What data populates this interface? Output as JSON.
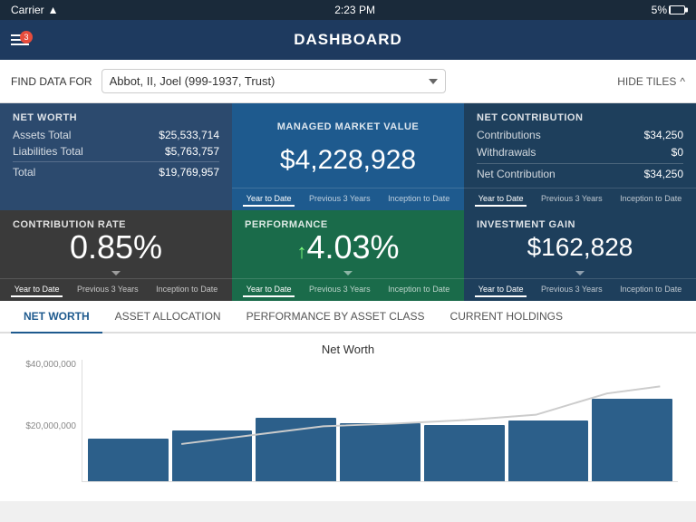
{
  "statusBar": {
    "carrier": "Carrier",
    "time": "2:23 PM",
    "battery": "5%"
  },
  "header": {
    "title": "DASHBOARD",
    "menuIcon": "☰",
    "notificationCount": "3"
  },
  "findData": {
    "label": "FIND DATA FOR",
    "selectedClient": "Abbot, II, Joel (999-1937, Trust)",
    "hideTilesLabel": "HIDE TILES"
  },
  "tiles": {
    "netWorth": {
      "title": "NET WORTH",
      "assetsLabel": "Assets Total",
      "assetsValue": "$25,533,714",
      "liabilitiesLabel": "Liabilities Total",
      "liabilitiesValue": "$5,763,757",
      "totalLabel": "Total",
      "totalValue": "$19,769,957"
    },
    "managedMarketValue": {
      "title": "MANAGED MARKET VALUE",
      "value": "$4,228,928",
      "dateTabs": [
        "Year to Date",
        "Previous 3 Years",
        "Inception to Date"
      ]
    },
    "netContribution": {
      "title": "NET CONTRIBUTION",
      "contributionsLabel": "Contributions",
      "contributionsValue": "$34,250",
      "withdrawalsLabel": "Withdrawals",
      "withdrawalsValue": "$0",
      "netContributionLabel": "Net Contribution",
      "netContributionValue": "$34,250",
      "dateTabs": [
        "Year to Date",
        "Previous 3 Years",
        "Inception to Date"
      ]
    },
    "contributionRate": {
      "title": "CONTRIBUTION RATE",
      "value": "0.85%",
      "dateTabs": [
        "Year to Date",
        "Previous 3 Years",
        "Inception to Date"
      ]
    },
    "performance": {
      "title": "PERFORMANCE",
      "arrow": "↑",
      "value": "4.03%",
      "dateTabs": [
        "Year to Date",
        "Previous 3 Years",
        "Inception to Date"
      ]
    },
    "investmentGain": {
      "title": "INVESTMENT GAIN",
      "value": "$162,828",
      "dateTabs": [
        "Year to Date",
        "Previous 3 Years",
        "Inception to Date"
      ]
    }
  },
  "tabs": [
    {
      "id": "net-worth",
      "label": "NET WORTH",
      "active": true
    },
    {
      "id": "asset-allocation",
      "label": "ASSET ALLOCATION",
      "active": false
    },
    {
      "id": "performance-by-asset-class",
      "label": "PERFORMANCE BY ASSET CLASS",
      "active": false
    },
    {
      "id": "current-holdings",
      "label": "CURRENT HOLDINGS",
      "active": false
    }
  ],
  "chart": {
    "title": "Net Worth",
    "yAxisLabels": [
      "$40,000,000",
      "$20,000,000",
      ""
    ],
    "bars": [
      {
        "height": 35,
        "label": ""
      },
      {
        "height": 42,
        "label": ""
      },
      {
        "height": 55,
        "label": ""
      },
      {
        "height": 50,
        "label": ""
      },
      {
        "height": 48,
        "label": ""
      },
      {
        "height": 52,
        "label": ""
      },
      {
        "height": 70,
        "label": ""
      }
    ]
  }
}
